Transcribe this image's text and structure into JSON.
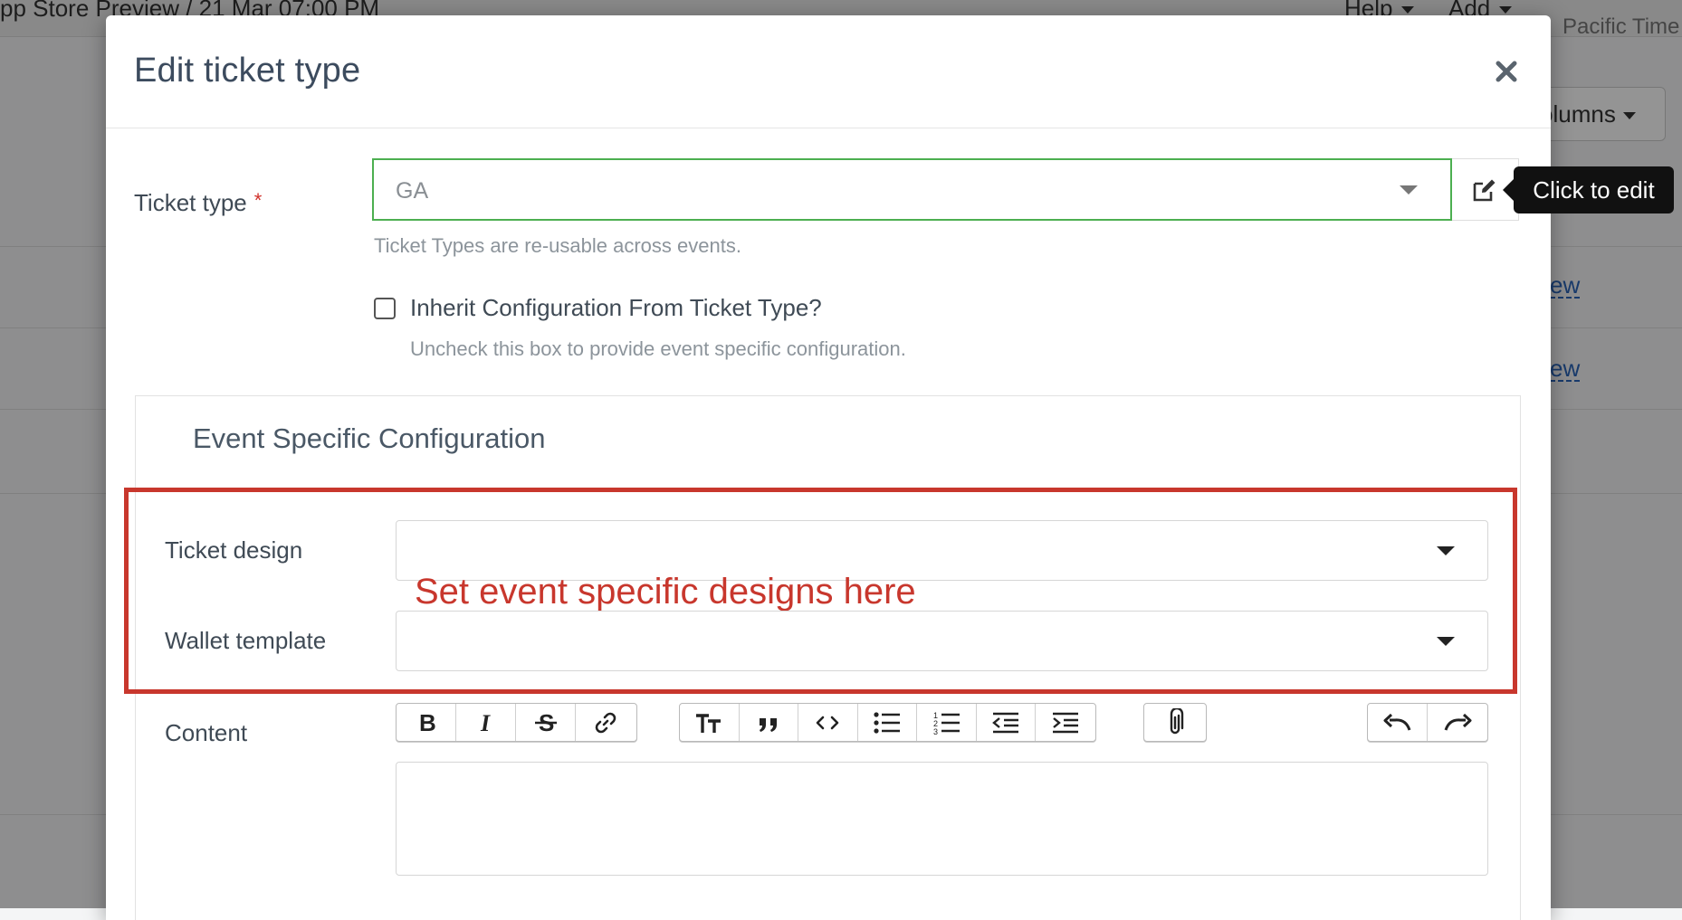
{
  "background": {
    "breadcrumb": "pp Store Preview  /  21 Mar 07:00 PM",
    "menu_help": "Help",
    "menu_add": "Add",
    "timezone": "Pacific Time",
    "columns_button": "olumns",
    "row_links": [
      "ew",
      "ew"
    ]
  },
  "modal": {
    "title": "Edit ticket type",
    "ticket_type": {
      "label": "Ticket type",
      "required_mark": "*",
      "value": "GA",
      "help": "Ticket Types are re-usable across events.",
      "edit_tooltip": "Click to edit"
    },
    "inherit": {
      "label": "Inherit Configuration From Ticket Type?",
      "help": "Uncheck this box to provide event specific configuration.",
      "checked": false
    },
    "event_config": {
      "title": "Event Specific Configuration",
      "ticket_design_label": "Ticket design",
      "ticket_design_value": "",
      "wallet_template_label": "Wallet template",
      "wallet_template_value": "",
      "content_label": "Content"
    },
    "annotation": "Set event specific designs here"
  },
  "colors": {
    "annotation": "#c8372d",
    "valid_border": "#4caf50",
    "required": "#d0302a"
  },
  "toolbar_icons": [
    "bold-icon",
    "italic-icon",
    "strikethrough-icon",
    "link-icon",
    "heading-icon",
    "quote-icon",
    "code-icon",
    "bullet-list-icon",
    "numbered-list-icon",
    "outdent-icon",
    "indent-icon",
    "attachment-icon",
    "undo-icon",
    "redo-icon"
  ]
}
